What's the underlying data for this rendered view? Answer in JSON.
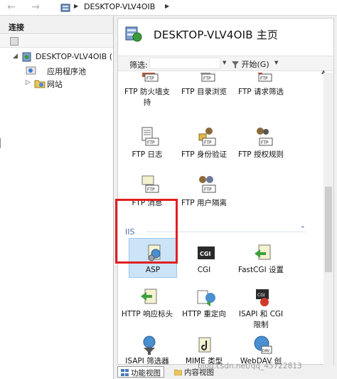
{
  "address": {
    "path": "DESKTOP-VLV4OIB"
  },
  "left": {
    "header": "连接",
    "tree": [
      {
        "label": "DESKTOP-VLV4OIB ("
      },
      {
        "label": "应用程序池"
      },
      {
        "label": "网站"
      }
    ]
  },
  "main": {
    "title": "DESKTOP-VLV4OIB 主页",
    "filter": {
      "label": "筛选:",
      "value": "",
      "go_label": "开始(G)"
    },
    "ftp_features": [
      {
        "label": "FTP 防火墙支持",
        "icon": "ftp-firewall-icon"
      },
      {
        "label": "FTP 目录浏览",
        "icon": "ftp-directory-browsing-icon"
      },
      {
        "label": "FTP 请求筛选",
        "icon": "ftp-request-filtering-icon"
      },
      {
        "label": "FTP 日志",
        "icon": "ftp-logging-icon"
      },
      {
        "label": "FTP 身份验证",
        "icon": "ftp-authentication-icon"
      },
      {
        "label": "FTP 授权规则",
        "icon": "ftp-authorization-icon"
      },
      {
        "label": "FTP 消息",
        "icon": "ftp-messages-icon"
      },
      {
        "label": "FTP 用户隔离",
        "icon": "ftp-user-isolation-icon"
      }
    ],
    "iis_section": "IIS",
    "iis_features": [
      {
        "label": "ASP",
        "icon": "asp-icon"
      },
      {
        "label": "CGI",
        "icon": "cgi-icon"
      },
      {
        "label": "FastCGI 设置",
        "icon": "fastcgi-icon"
      },
      {
        "label": "HTTP 响应标头",
        "icon": "http-response-headers-icon"
      },
      {
        "label": "HTTP 重定向",
        "icon": "http-redirect-icon"
      },
      {
        "label": "ISAPI 和 CGI 限制",
        "icon": "isapi-cgi-restrictions-icon"
      },
      {
        "label": "ISAPI 筛选器",
        "icon": "isapi-filters-icon"
      },
      {
        "label": "MIME 类型",
        "icon": "mime-types-icon"
      },
      {
        "label": "WebDAV 创",
        "icon": "webdav-icon"
      }
    ]
  },
  "bottom": {
    "features_view": "功能视图",
    "content_view": "内容视图"
  },
  "watermark": "blog.csdn.net/qq_45722813",
  "colors": {
    "selection": "#cce4f7",
    "highlight_border": "#e02020",
    "section_header": "#4a6fa5"
  }
}
